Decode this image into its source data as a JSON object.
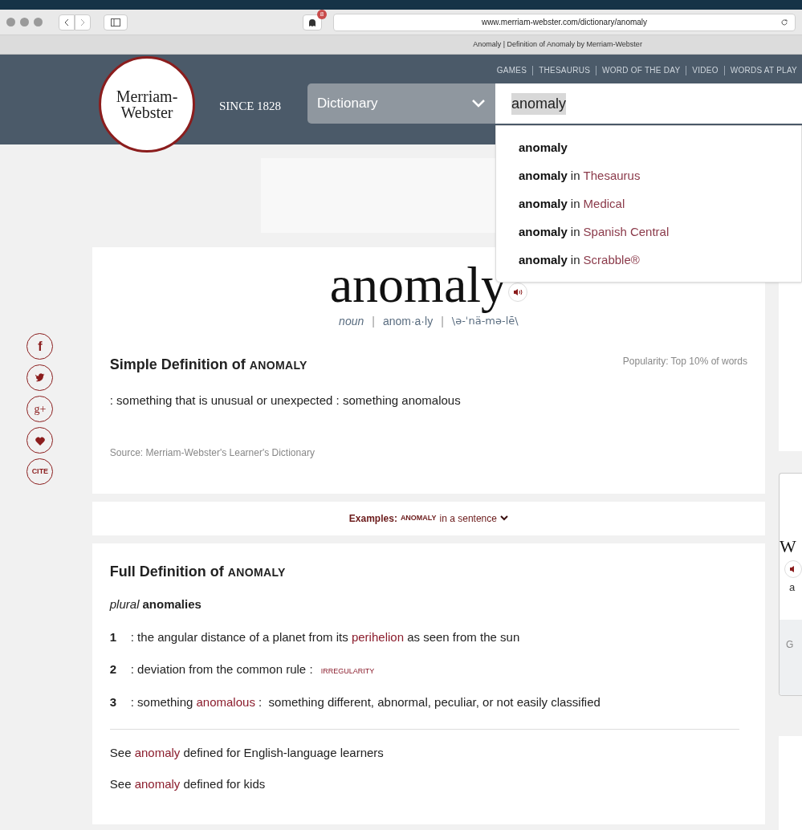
{
  "browser": {
    "badge": "8",
    "url": "www.merriam-webster.com/dictionary/anomaly",
    "tab_title": "Anomaly | Definition of Anomaly by Merriam-Webster"
  },
  "header": {
    "nav": [
      "GAMES",
      "THESAURUS",
      "WORD OF THE DAY",
      "VIDEO",
      "WORDS AT PLAY"
    ],
    "logo_lines": [
      "Merriam-",
      "Webster"
    ],
    "since": "SINCE 1828",
    "select": "Dictionary",
    "search_value": "anomaly"
  },
  "suggestions": [
    {
      "word": "anomaly"
    },
    {
      "word": "anomaly",
      "in": "in",
      "source": "Thesaurus"
    },
    {
      "word": "anomaly",
      "in": "in",
      "source": "Medical"
    },
    {
      "word": "anomaly",
      "in": "in",
      "source": "Spanish Central"
    },
    {
      "word": "anomaly",
      "in": "in",
      "source": "Scrabble®"
    }
  ],
  "share": [
    "f",
    "g+",
    "CITE"
  ],
  "entry": {
    "headword": "anomaly",
    "pos": "noun",
    "syllables": "anom·a·ly",
    "pronunciation": "\\ə-ˈnä-mə-lē\\",
    "separators": [
      "|",
      "|"
    ]
  },
  "simple": {
    "title": "Simple Definition of",
    "word": "ANOMALY",
    "popularity": "Popularity: Top 10% of words",
    "definition": ": something that is unusual or unexpected : something anomalous",
    "source": "Source: Merriam-Webster's Learner's Dictionary"
  },
  "examples": {
    "label": "Examples:",
    "word": "ANOMALY",
    "rest": "in a sentence"
  },
  "full": {
    "title": "Full Definition of",
    "word": "ANOMALY",
    "plural_label": "plural",
    "plural": "anomalies",
    "senses": [
      {
        "num": "1",
        "parts": [
          {
            "t": ": the angular distance of a planet from its "
          },
          {
            "t": "perihelion",
            "link": true
          },
          {
            "t": " as seen from the sun"
          }
        ]
      },
      {
        "num": "2",
        "parts": [
          {
            "t": ": deviation from the common rule : "
          },
          {
            "t": "IRREGULARITY",
            "link": true,
            "small": true
          }
        ]
      },
      {
        "num": "3",
        "parts": [
          {
            "t": ": something "
          },
          {
            "t": "anomalous",
            "link": true
          },
          {
            "t": " :  something different, abnormal, peculiar, or not easily classified"
          }
        ]
      }
    ],
    "see": [
      {
        "a": "See ",
        "link": "anomaly",
        "b": " defined for English-language learners"
      },
      {
        "a": "See ",
        "link": "anomaly",
        "b": " defined for kids"
      }
    ]
  },
  "side": {
    "letter": "W",
    "text": "a",
    "label": "G"
  }
}
